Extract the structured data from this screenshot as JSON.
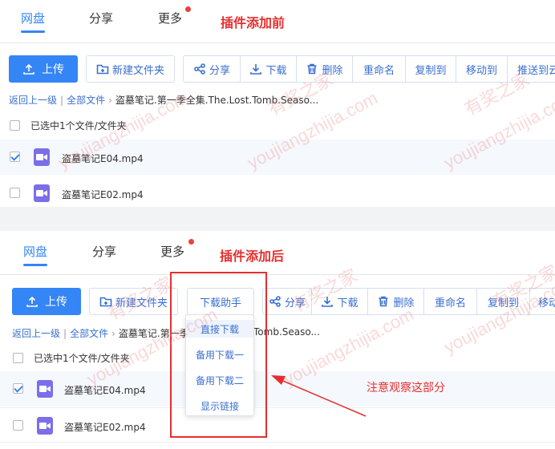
{
  "before": {
    "tabs": [
      "网盘",
      "分享",
      "更多"
    ],
    "annotation": "插件添加前",
    "toolbar": {
      "upload": "上传",
      "new_folder": "新建文件夹",
      "share": "分享",
      "download": "下载",
      "delete": "删除",
      "rename": "重命名",
      "copy_to": "复制到",
      "move_to": "移动到",
      "push_to": "推送到云"
    },
    "breadcrumb": {
      "back": "返回上一级",
      "all": "全部文件",
      "path": "盗墓笔记.第一季全集.The.Lost.Tomb.Seaso..."
    },
    "selection": "已选中1个文件/文件夹",
    "files": [
      {
        "name": "盗墓笔记E04.mp4",
        "checked": true
      },
      {
        "name": "盗墓笔记E02.mp4",
        "checked": false
      }
    ]
  },
  "after": {
    "tabs": [
      "网盘",
      "分享",
      "更多"
    ],
    "annotation": "插件添加后",
    "toolbar": {
      "upload": "上传",
      "new_folder": "新建文件夹",
      "download_helper": "下载助手",
      "share": "分享",
      "download": "下载",
      "delete": "删除",
      "rename": "重命名",
      "copy_to": "复制到",
      "move_to": "移动"
    },
    "breadcrumb": {
      "back": "返回上一级",
      "all": "全部文件",
      "path": "盗墓笔记.第一季",
      "path_tail": "Tomb.Seaso..."
    },
    "selection": "已选中1个文件/文件夹",
    "files": [
      {
        "name": "盗墓笔记E04.mp4",
        "checked": true
      },
      {
        "name": "盗墓笔记E02.mp4",
        "checked": false
      }
    ],
    "dropdown": [
      "直接下载",
      "备用下载一",
      "备用下载二",
      "显示链接"
    ],
    "note": "注意观察这部分"
  },
  "watermark": {
    "cn": "有奖之家",
    "en": "youjiangzhijia.com"
  },
  "colors": {
    "accent": "#3485f5",
    "annotation_red": "#e62e2e",
    "file_icon": "#7b6ee8"
  }
}
